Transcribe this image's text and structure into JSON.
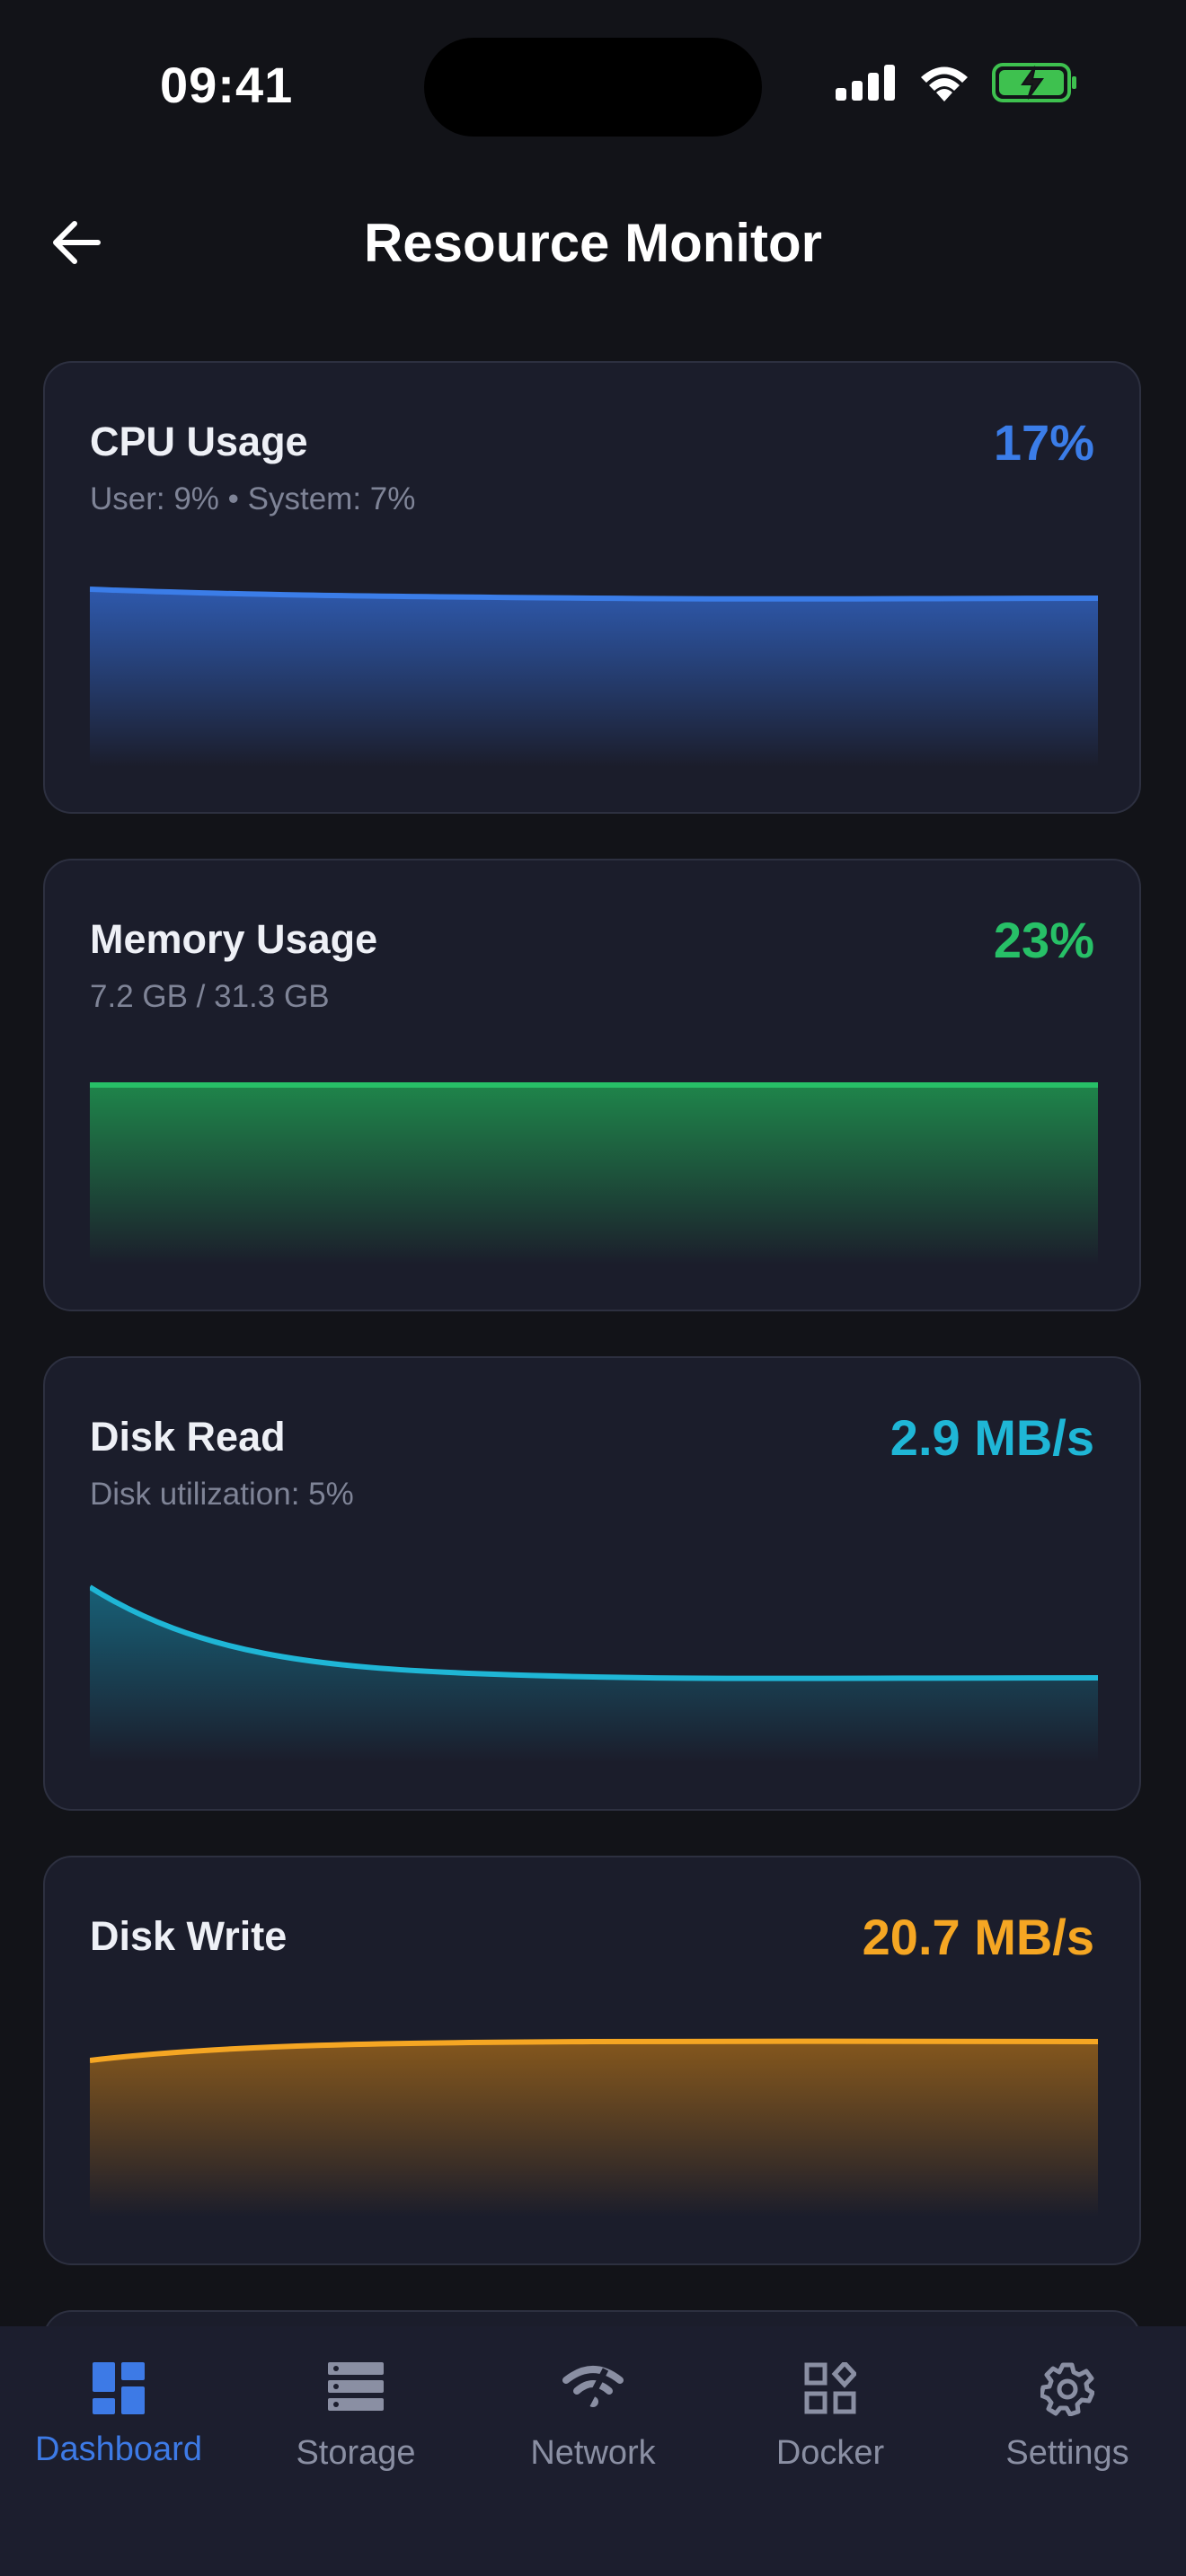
{
  "status": {
    "time": "09:41"
  },
  "header": {
    "title": "Resource Monitor"
  },
  "cards": [
    {
      "title": "CPU Usage",
      "subtitle": "User: 9% • System: 7%",
      "value": "17%",
      "color": "#3b7de8"
    },
    {
      "title": "Memory Usage",
      "subtitle": "7.2 GB / 31.3 GB",
      "value": "23%",
      "color": "#27c067"
    },
    {
      "title": "Disk Read",
      "subtitle": "Disk utilization: 5%",
      "value": "2.9 MB/s",
      "color": "#1fb6d6"
    },
    {
      "title": "Disk Write",
      "subtitle": "",
      "value": "20.7 MB/s",
      "color": "#f5a623"
    }
  ],
  "nav": [
    {
      "label": "Dashboard",
      "icon": "dashboard-icon",
      "active": true
    },
    {
      "label": "Storage",
      "icon": "storage-icon",
      "active": false
    },
    {
      "label": "Network",
      "icon": "network-icon",
      "active": false
    },
    {
      "label": "Docker",
      "icon": "docker-icon",
      "active": false
    },
    {
      "label": "Settings",
      "icon": "settings-icon",
      "active": false
    }
  ]
}
